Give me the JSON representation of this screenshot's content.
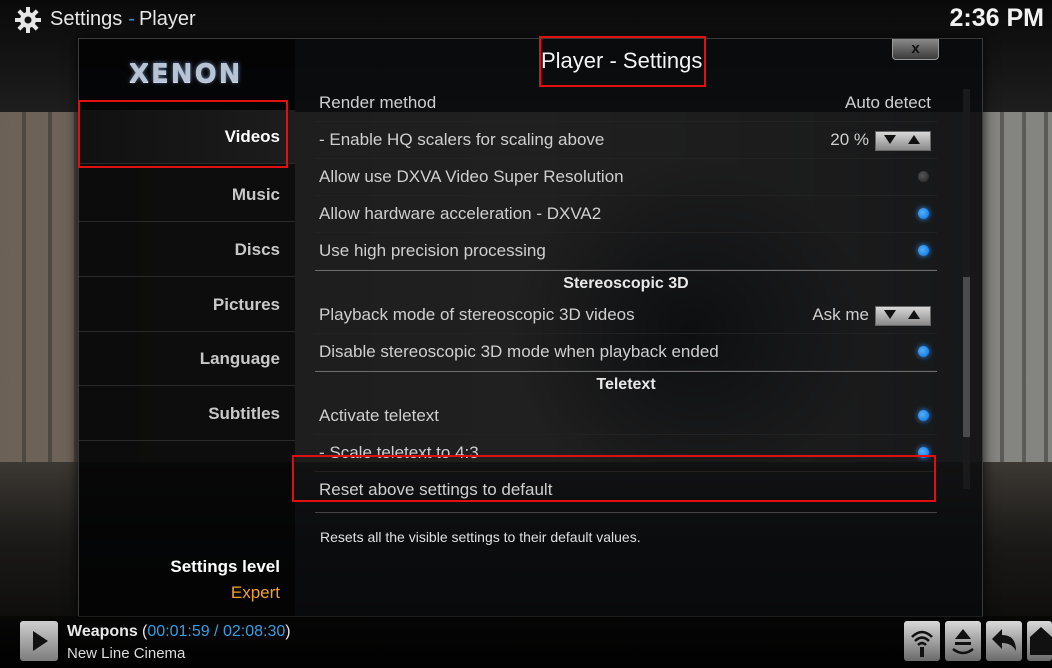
{
  "header": {
    "section": "Settings",
    "subsection": "Player",
    "separator": "-",
    "clock": "2:36 PM"
  },
  "dialog": {
    "title": "Player - Settings",
    "close_label": "x",
    "logo": "XENON"
  },
  "sidebar": {
    "items": [
      {
        "label": "Videos",
        "active": true
      },
      {
        "label": "Music"
      },
      {
        "label": "Discs"
      },
      {
        "label": "Pictures"
      },
      {
        "label": "Language"
      },
      {
        "label": "Subtitles"
      }
    ],
    "settings_level_label": "Settings level",
    "settings_level_value": "Expert"
  },
  "settings": {
    "render_method": {
      "label": "Render method",
      "value": "Auto detect"
    },
    "hq_scalers": {
      "label": "- Enable HQ scalers for scaling above",
      "value": "20 %"
    },
    "dxva_super_res": {
      "label": "Allow use DXVA Video Super Resolution",
      "enabled": false
    },
    "hw_accel_dxva2": {
      "label": "Allow hardware acceleration - DXVA2",
      "enabled": true
    },
    "high_precision": {
      "label": "Use high precision processing",
      "enabled": true
    },
    "section_3d": "Stereoscopic 3D",
    "playback_3d": {
      "label": "Playback mode of stereoscopic 3D videos",
      "value": "Ask me"
    },
    "disable_3d": {
      "label": "Disable stereoscopic 3D mode when playback ended",
      "enabled": true
    },
    "section_teletext": "Teletext",
    "activate_teletext": {
      "label": "Activate teletext",
      "enabled": true
    },
    "scale_teletext": {
      "label": "- Scale teletext to 4:3",
      "enabled": true
    },
    "reset": {
      "label": "Reset above settings to default"
    }
  },
  "description": "Resets all the visible settings to their default values.",
  "now_playing": {
    "title": "Weapons",
    "time_open": "(",
    "elapsed": "00:01:59",
    "time_sep": " / ",
    "total": "02:08:30",
    "time_close": ")",
    "subtitle": "New Line Cinema"
  },
  "colors": {
    "accent": "#3a9de0",
    "highlight_box": "#e01010",
    "settings_level_value": "#f0a030"
  },
  "icons": [
    "settings-gear-icon",
    "play-icon",
    "wifi-icon",
    "eject-icon",
    "back-icon",
    "home-icon"
  ]
}
